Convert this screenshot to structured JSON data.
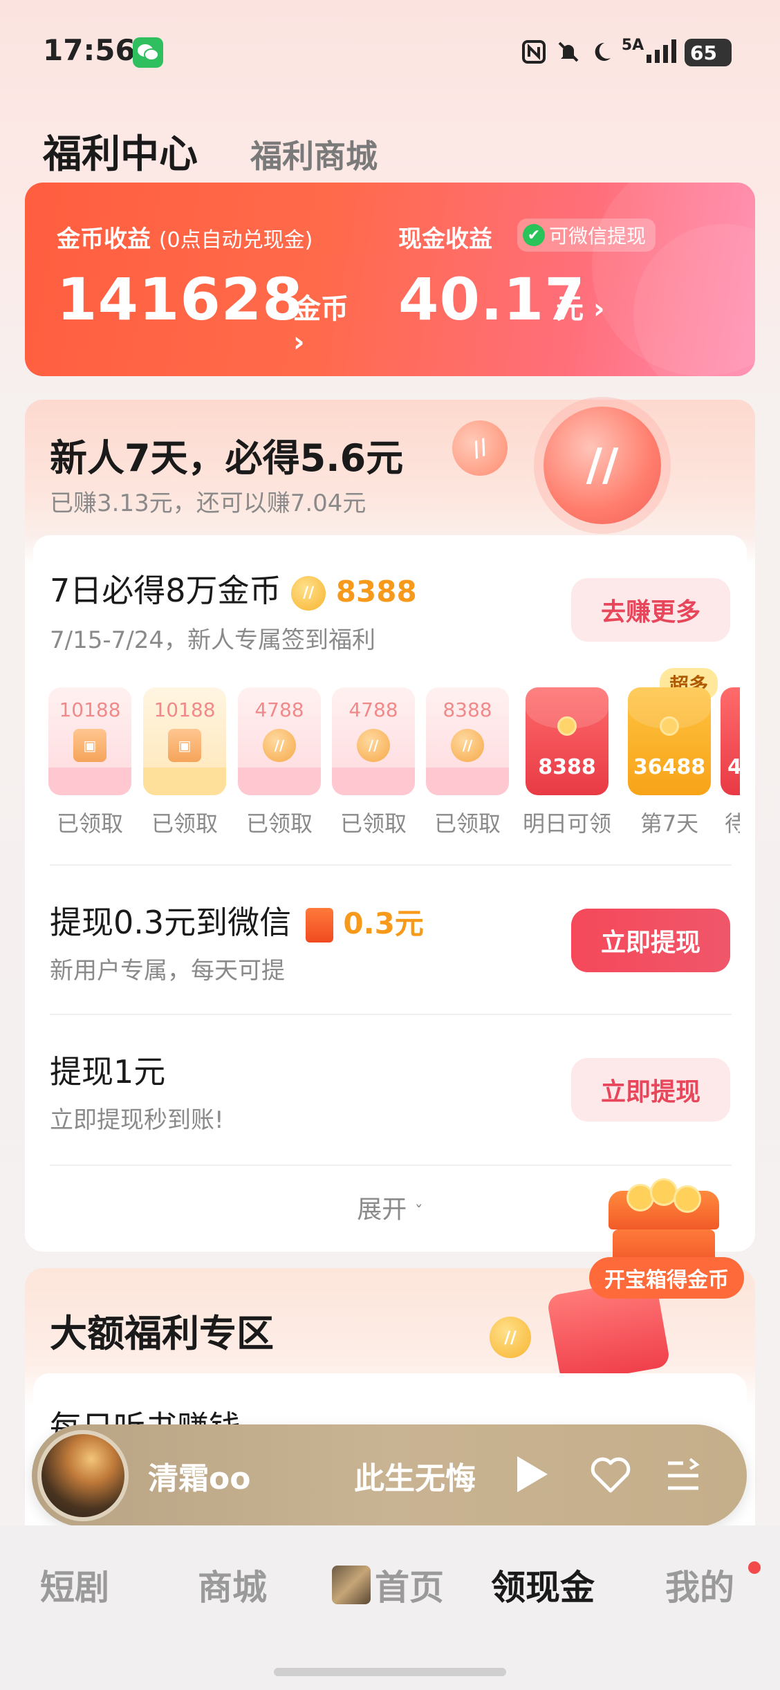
{
  "status_bar": {
    "time": "17:56",
    "network": "5A",
    "battery": "65",
    "icons": [
      "wechat-notification-icon",
      "nfc-icon",
      "mute-icon",
      "moon-icon",
      "signal-icon",
      "battery-icon"
    ]
  },
  "header": {
    "title": "福利中心",
    "tab_shop": "福利商城"
  },
  "earnings": {
    "coin_label": "金币收益",
    "coin_note": "(0点自动兑现金)",
    "coin_value": "141628",
    "coin_unit": "金币",
    "cash_label": "现金收益",
    "cash_badge": "可微信提现",
    "cash_value": "40.17",
    "cash_unit": "元",
    "chevron": "›"
  },
  "newbie": {
    "title": "新人7天，必得5.6元",
    "subtitle": "已赚3.13元，还可以赚7.04元",
    "coin_glyph": "//"
  },
  "checkin": {
    "title": "7日必得8万金币",
    "reward": "8388",
    "subtitle": "7/15-7/24，新人专属签到福利",
    "button": "去赚更多",
    "super_badge": "超多",
    "days": [
      {
        "amount": "10188",
        "label": "已领取"
      },
      {
        "amount": "10188",
        "label": "已领取"
      },
      {
        "amount": "4788",
        "label": "已领取"
      },
      {
        "amount": "4788",
        "label": "已领取"
      },
      {
        "amount": "8388",
        "label": "已领取"
      },
      {
        "amount": "8388",
        "label": "明日可领"
      },
      {
        "amount": "36488",
        "label": "第7天"
      },
      {
        "amount": "4",
        "label": "待"
      }
    ]
  },
  "withdraw1": {
    "title": "提现0.3元到微信",
    "reward": "0.3元",
    "subtitle": "新用户专属，每天可提",
    "button": "立即提现"
  },
  "withdraw2": {
    "title": "提现1元",
    "subtitle": "立即提现秒到账!",
    "button": "立即提现"
  },
  "expand_label": "展开",
  "expand_chevron": "ˇ",
  "chest_label": "开宝箱得金币",
  "big_welfare": {
    "title": "大额福利专区",
    "hidden_row": "每日听书赚钱"
  },
  "player": {
    "author": "清霜oo",
    "book": "此生无悔"
  },
  "nav": {
    "items": [
      "短剧",
      "商城",
      "首页",
      "领现金",
      "我的"
    ],
    "active": "领现金"
  }
}
